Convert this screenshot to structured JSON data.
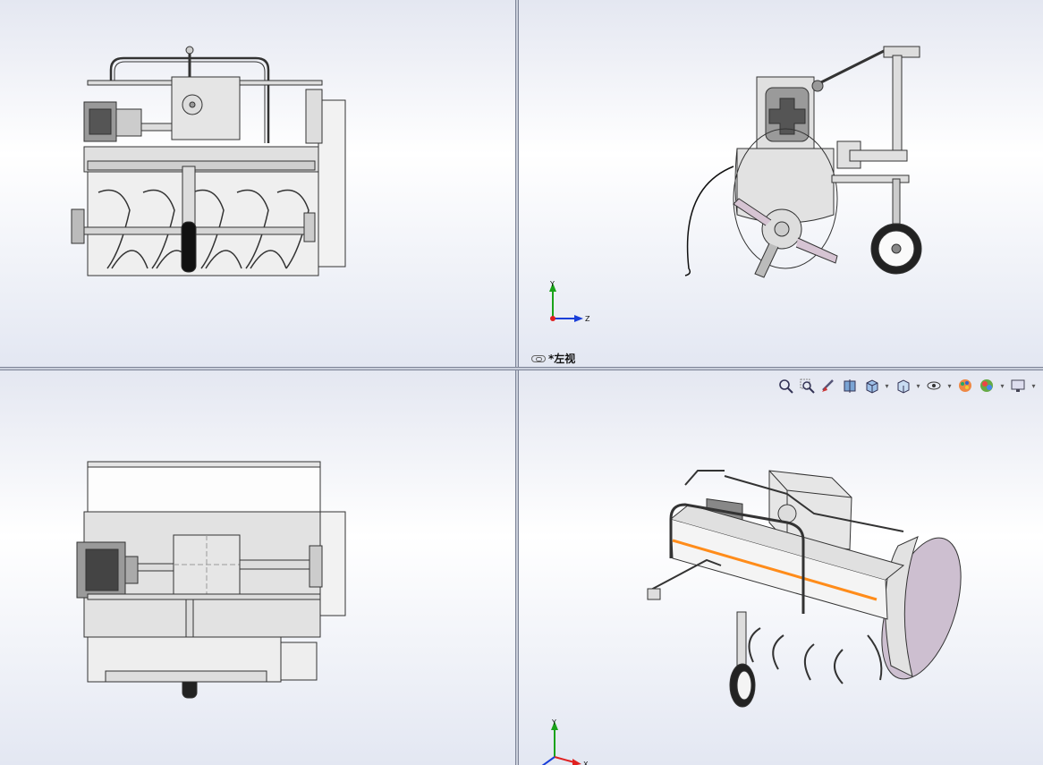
{
  "views": {
    "left_view_label": "*左视"
  },
  "triad": {
    "x": "X",
    "y": "Y",
    "z": "Z"
  },
  "toolbar": {
    "buttons": [
      {
        "name": "zoom-to-fit"
      },
      {
        "name": "zoom-to-area"
      },
      {
        "name": "previous-view"
      },
      {
        "name": "section-view"
      },
      {
        "name": "view-orientation",
        "dropdown": true
      },
      {
        "name": "display-style",
        "dropdown": true
      },
      {
        "name": "hide-show-items",
        "dropdown": true
      },
      {
        "name": "edit-appearance"
      },
      {
        "name": "apply-scene",
        "dropdown": true
      },
      {
        "name": "view-settings",
        "dropdown": true
      }
    ]
  },
  "colors": {
    "model_line": "#333333",
    "model_fill": "#e8e8e8",
    "accent_orange": "#ff8c1a",
    "cover_fill": "#cdbfd0",
    "triad_x": "#e02020",
    "triad_y": "#1aa31a",
    "triad_z": "#1a3fd9"
  }
}
